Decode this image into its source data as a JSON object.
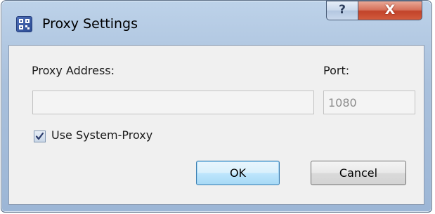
{
  "window": {
    "title": "Proxy Settings",
    "help_glyph": "?",
    "close_glyph": "X",
    "app_icon": "proxy-app-icon"
  },
  "form": {
    "proxy_address_label": "Proxy Address:",
    "proxy_address_value": "",
    "port_label": "Port:",
    "port_value": "1080",
    "use_system_proxy_label": "Use System-Proxy",
    "use_system_proxy_checked": true
  },
  "buttons": {
    "ok_label": "OK",
    "cancel_label": "Cancel"
  }
}
